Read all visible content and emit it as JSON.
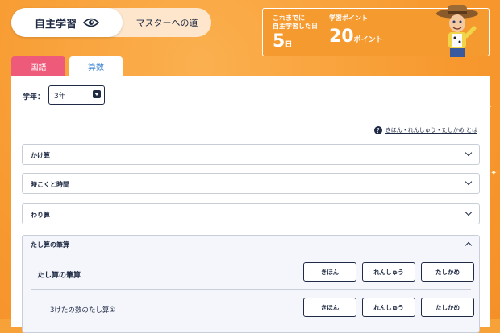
{
  "header": {
    "mode_self_label": "自主学習",
    "mode_master_label": "マスターへの道"
  },
  "stats": {
    "days_caption_line1": "これまでに",
    "days_caption_line2": "自主学習した日",
    "days_value": "5",
    "days_unit": "日",
    "points_caption": "学習ポイント",
    "points_value": "20",
    "points_unit": "ポイント"
  },
  "tabs": [
    {
      "label": "国語",
      "active": false
    },
    {
      "label": "算数",
      "active": true
    }
  ],
  "grade": {
    "label": "学年：",
    "selected": "3年"
  },
  "help": {
    "icon": "?",
    "text": "きほん・れんしゅう・たしかめ とは"
  },
  "sections": [
    {
      "title": "かけ算"
    },
    {
      "title": "時こくと時間"
    },
    {
      "title": "わり算"
    }
  ],
  "open_section": {
    "title": "たし算の筆算",
    "rows": [
      {
        "name": "たし算の筆算",
        "buttons": [
          "きほん",
          "れんしゅう",
          "たしかめ"
        ]
      },
      {
        "name": "3けたの数のたし算①",
        "buttons": [
          "きほん",
          "れんしゅう",
          "たしかめ"
        ]
      }
    ]
  },
  "colors": {
    "background": "#f7a238",
    "kokugo_tab": "#ee5a7a",
    "sansu_tab_text": "#2e7bd0",
    "navy": "#1f2a44"
  }
}
